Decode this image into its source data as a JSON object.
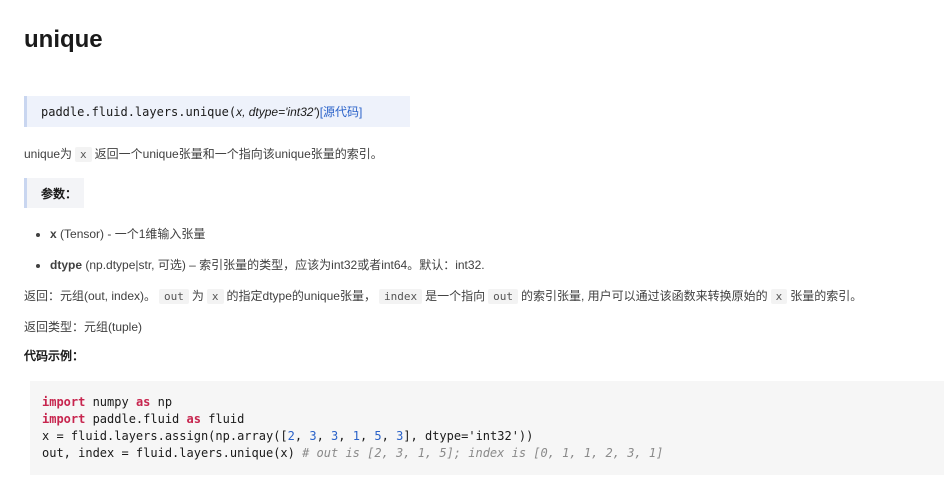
{
  "title": "unique",
  "signature": {
    "func": "paddle.fluid.layers.unique(",
    "args": "x, dtype='int32'",
    "close": ")",
    "source_link": "[源代码]"
  },
  "description": {
    "pre": "unique为",
    "code": "x",
    "post": "返回一个unique张量和一个指向该unique张量的索引。"
  },
  "params_label": "参数：",
  "params": [
    {
      "name": "x",
      "desc": " (Tensor) - 一个1维输入张量"
    },
    {
      "name": "dtype",
      "desc": " (np.dtype|str, 可选) – 索引张量的类型，应该为int32或者int64。默认：int32."
    }
  ],
  "returns": {
    "t1": "返回：元组(out, index)。",
    "c1": "out",
    "t2": "为",
    "c2": "x",
    "t3": "的指定dtype的unique张量，",
    "c3": "index",
    "t4": "是一个指向",
    "c4": "out",
    "t5": "的索引张量, 用户可以通过该函数来转换原始的",
    "c5": "x",
    "t6": "张量的索引。"
  },
  "return_type": "返回类型：元组(tuple)",
  "example_label": "代码示例：",
  "code": {
    "l1_kw1": "import",
    "l1_mid": " numpy ",
    "l1_kw2": "as",
    "l1_end": " np",
    "l2_kw1": "import",
    "l2_mid": " paddle.fluid ",
    "l2_kw2": "as",
    "l2_end": " fluid",
    "l3_a": "x = fluid.layers.assign(np.array([",
    "l3_n1": "2",
    "l3_n2": "3",
    "l3_n3": "3",
    "l3_n4": "1",
    "l3_n5": "5",
    "l3_n6": "3",
    "l3_b": "], dtype=",
    "l3_str": "'int32'",
    "l3_c": "))",
    "l4_a": "out, index = fluid.layers.unique(x) ",
    "l4_cmt": "# out is [2, 3, 1, 5]; index is [0, 1, 1, 2, 3, 1]"
  }
}
